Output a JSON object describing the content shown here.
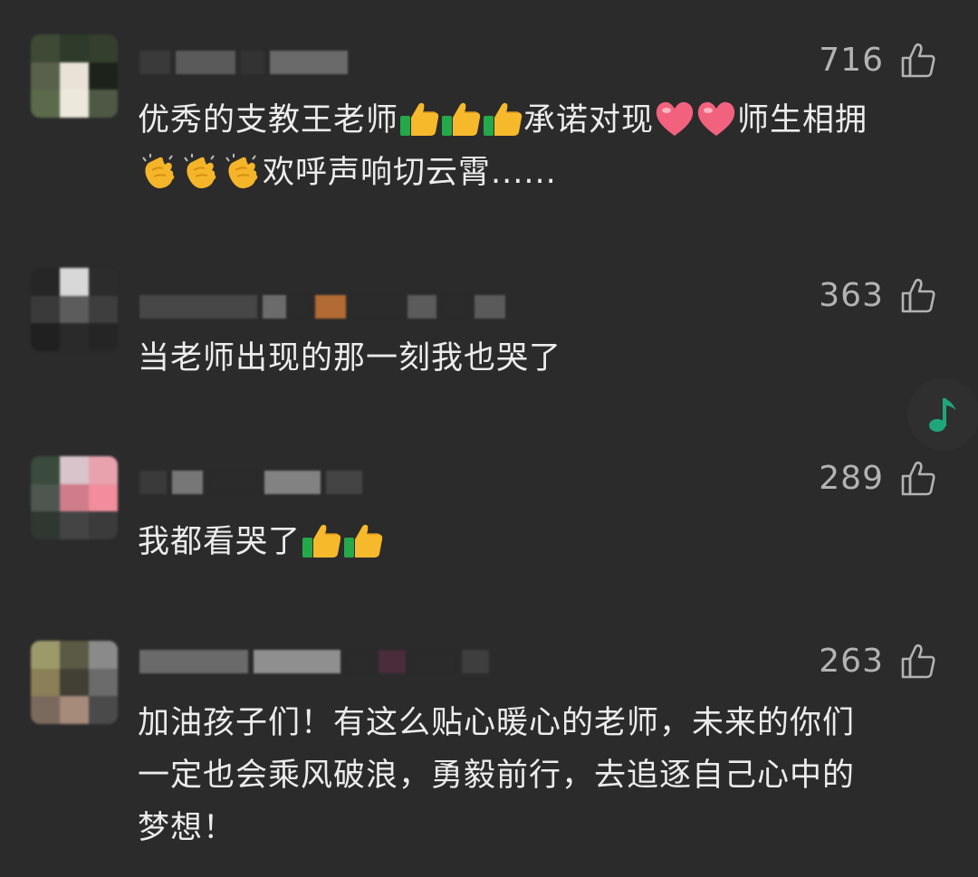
{
  "comments": [
    {
      "likes": "716",
      "text_line1": "优秀的支教王老师",
      "text_line1b": "承诺对现",
      "text_line1c": "师生相拥",
      "text_line2": "欢呼声响切云霄......"
    },
    {
      "likes": "363",
      "text": "当老师出现的那一刻我也哭了"
    },
    {
      "likes": "289",
      "text": "我都看哭了"
    },
    {
      "likes": "263",
      "text_line1": "加油孩子们！有这么贴心暖心的老师，未来的你们",
      "text_line2": "一定也会乘风破浪，勇毅前行，去追逐自己心中的",
      "text_line3": "梦想！"
    }
  ],
  "icons": {
    "like": "thumbs-up-outline-icon",
    "music": "music-note-icon",
    "emoji_thumbs": "thumbs-up-emoji",
    "emoji_heart": "heart-emoji",
    "emoji_clap": "clapping-hands-emoji"
  },
  "colors": {
    "background": "#2b2b2b",
    "text": "#ececec",
    "like_count": "#b3b3b3",
    "accent_music": "#1fa67a"
  }
}
